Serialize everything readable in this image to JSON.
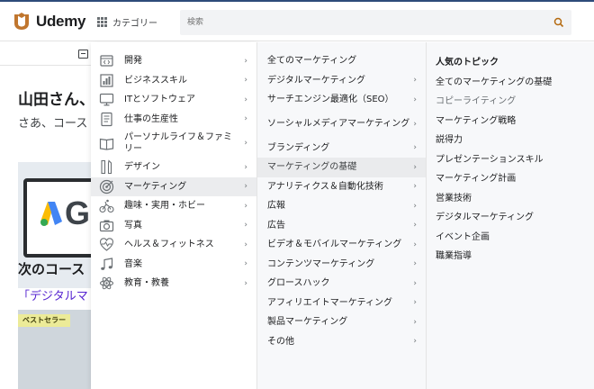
{
  "header": {
    "logo_text": "Udemy",
    "category_label": "カテゴリー",
    "search_placeholder": "検索"
  },
  "background": {
    "greeting": "山田さん、",
    "greeting_sub": "さあ、コース",
    "next_title": "次のコース",
    "next_link": "「デジタルマ",
    "badge": "ベストセラー"
  },
  "categories": [
    {
      "label": "開発",
      "icon": "code-icon"
    },
    {
      "label": "ビジネススキル",
      "icon": "chart-icon"
    },
    {
      "label": "ITとソフトウェア",
      "icon": "monitor-icon"
    },
    {
      "label": "仕事の生産性",
      "icon": "document-icon"
    },
    {
      "label": "パーソナルライフ＆ファミリー",
      "icon": "book-icon"
    },
    {
      "label": "デザイン",
      "icon": "pen-ruler-icon"
    },
    {
      "label": "マーケティング",
      "icon": "target-icon"
    },
    {
      "label": "趣味・実用・ホビー",
      "icon": "cycling-icon"
    },
    {
      "label": "写真",
      "icon": "camera-icon"
    },
    {
      "label": "ヘルス＆フィットネス",
      "icon": "heart-pulse-icon"
    },
    {
      "label": "音楽",
      "icon": "music-icon"
    },
    {
      "label": "教育・教養",
      "icon": "atom-icon"
    }
  ],
  "subcategories": [
    "全てのマーケティング",
    "デジタルマーケティング",
    "サーチエンジン最適化（SEO）",
    "ソーシャルメディアマーケティング",
    "ブランディング",
    "マーケティングの基礎",
    "アナリティクス＆自動化技術",
    "広報",
    "広告",
    "ビデオ＆モバイルマーケティング",
    "コンテンツマーケティング",
    "グロースハック",
    "アフィリエイトマーケティング",
    "製品マーケティング",
    "その他"
  ],
  "topics": {
    "heading": "人気のトピック",
    "items": [
      "全てのマーケティングの基礎",
      "コピーライティング",
      "マーケティング戦略",
      "説得力",
      "プレゼンテーションスキル",
      "マーケティング計画",
      "営業技術",
      "デジタルマーケティング",
      "イベント企画",
      "職業指導"
    ]
  },
  "colors": {
    "brand": "#a435f0",
    "logo_mark": "#c0762e",
    "link": "#5624d0",
    "active_bg": "#ebecee"
  }
}
